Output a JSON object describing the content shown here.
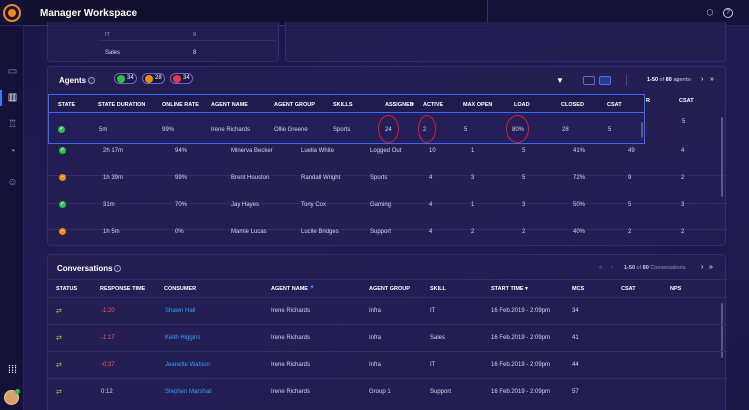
{
  "app": {
    "title": "Manager Workspace"
  },
  "top_icons": [
    "cube-icon",
    "help-icon"
  ],
  "sidebar": {
    "items": [
      "messages-icon",
      "analytics-icon",
      "trophy-icon",
      "clock-icon",
      "users-icon",
      "apps-grid-icon",
      "user-avatar"
    ]
  },
  "summary_partial": {
    "row_label_1": "IT",
    "row_value_1": "9",
    "row_label_2": "Sales",
    "row_value_2": "8"
  },
  "agents": {
    "title": "Agents",
    "counts": {
      "online": "34",
      "away": "28",
      "offline": "34"
    },
    "pagination": "1-50 of 80 agents",
    "pagination_prefix": "1-50",
    "pagination_total": "80",
    "pagination_suffix": "agents",
    "headers": [
      "STATE",
      "STATE DURATION",
      "ONLINE RATE",
      "AGENT NAME",
      "AGENT GROUP",
      "SKILLS",
      "ASSIGNED",
      "ACTIVE",
      "MAX OPEN",
      "LOAD",
      "CLOSED",
      "CSAT"
    ],
    "extra_header": "CSAT",
    "rows": [
      {
        "state": "green",
        "duration": "5m",
        "online_rate": "99%",
        "name": "Irene Richards",
        "group": "Ollie Greene",
        "skills": "Sports",
        "assigned": "24",
        "active": "2",
        "max_open": "5",
        "load": "80%",
        "closed": "28",
        "csat": "5",
        "csat2": "5"
      },
      {
        "state": "green",
        "duration": "2h 17m",
        "online_rate": "94%",
        "name": "Minerva Becker",
        "group": "Luella White",
        "skills": "Logged Out",
        "assigned": "10",
        "active": "1",
        "max_open": "5",
        "load": "41%",
        "closed": "49",
        "csat": "4"
      },
      {
        "state": "orange",
        "duration": "1h 39m",
        "online_rate": "99%",
        "name": "Brent Houston",
        "group": "Randall Wright",
        "skills": "Sports",
        "assigned": "4",
        "active": "3",
        "max_open": "5",
        "load": "72%",
        "closed": "9",
        "csat": "2"
      },
      {
        "state": "green",
        "duration": "31m",
        "online_rate": "70%",
        "name": "Jay Hayes",
        "group": "Tony Cox",
        "skills": "Gaming",
        "assigned": "4",
        "active": "1",
        "max_open": "3",
        "load": "50%",
        "closed": "5",
        "csat": "3"
      },
      {
        "state": "orange",
        "duration": "1h 5m",
        "online_rate": "0%",
        "name": "Mamie Lucas",
        "group": "Lucile Bridges",
        "skills": "Support",
        "assigned": "4",
        "active": "2",
        "max_open": "2",
        "load": "40%",
        "closed": "2",
        "csat": "2"
      }
    ]
  },
  "conversations": {
    "title": "Conversations",
    "pagination_prefix": "1-50",
    "pagination_total": "80",
    "pagination_suffix": "Conversations",
    "headers": [
      "STATUS",
      "RESPONSE TIME",
      "CONSUMER",
      "AGENT NAME",
      "AGENT GROUP",
      "SKILL",
      "START TIME",
      "MCS",
      "CSAT",
      "NPS"
    ],
    "rows": [
      {
        "response": "-1:20",
        "consumer": "Shawn Hall",
        "agent": "Irene Richards",
        "group": "Infra",
        "skill": "IT",
        "start": "16 Feb.2019 - 2:09pm",
        "mcs": "34"
      },
      {
        "response": "-1:17",
        "consumer": "Keith Higgins",
        "agent": "Irene Richards",
        "group": "Infra",
        "skill": "Sales",
        "start": "16 Feb.2019 - 2:09pm",
        "mcs": "41"
      },
      {
        "response": "-0:37",
        "consumer": "Jeanette Watson",
        "agent": "Irene Richards",
        "group": "Infra",
        "skill": "IT",
        "start": "16 Feb.2019 - 2:09pm",
        "mcs": "44"
      },
      {
        "response": "0:12",
        "consumer": "Stephen Marshall",
        "agent": "Irene Richards",
        "group": "Group 1",
        "skill": "Support",
        "start": "16 Feb.2019 - 2:09pm",
        "mcs": "57"
      }
    ]
  }
}
